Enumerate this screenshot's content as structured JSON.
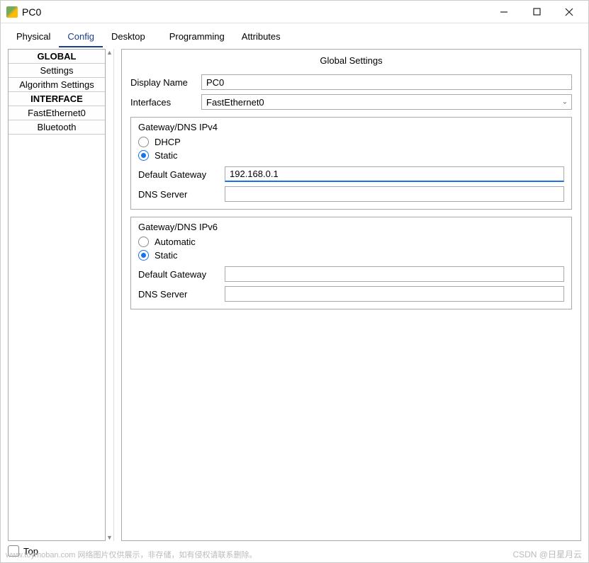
{
  "window": {
    "title": "PC0"
  },
  "tabs": {
    "physical": "Physical",
    "config": "Config",
    "desktop": "Desktop",
    "programming": "Programming",
    "attributes": "Attributes"
  },
  "sidebar": {
    "global_header": "GLOBAL",
    "settings": "Settings",
    "algorithm_settings": "Algorithm Settings",
    "interface_header": "INTERFACE",
    "fastethernet0": "FastEthernet0",
    "bluetooth": "Bluetooth"
  },
  "panel": {
    "title": "Global Settings",
    "display_name_label": "Display Name",
    "display_name_value": "PC0",
    "interfaces_label": "Interfaces",
    "interfaces_value": "FastEthernet0"
  },
  "ipv4": {
    "legend": "Gateway/DNS IPv4",
    "dhcp": "DHCP",
    "static": "Static",
    "default_gateway_label": "Default Gateway",
    "default_gateway_value": "192.168.0.1",
    "dns_server_label": "DNS Server",
    "dns_server_value": ""
  },
  "ipv6": {
    "legend": "Gateway/DNS IPv6",
    "automatic": "Automatic",
    "static": "Static",
    "default_gateway_label": "Default Gateway",
    "default_gateway_value": "",
    "dns_server_label": "DNS Server",
    "dns_server_value": ""
  },
  "bottom": {
    "top_label": "Top"
  },
  "watermarks": {
    "left": "www.toymoban.com 网络图片仅供展示，非存储，如有侵权请联系删除。",
    "right": "CSDN @日星月云"
  }
}
